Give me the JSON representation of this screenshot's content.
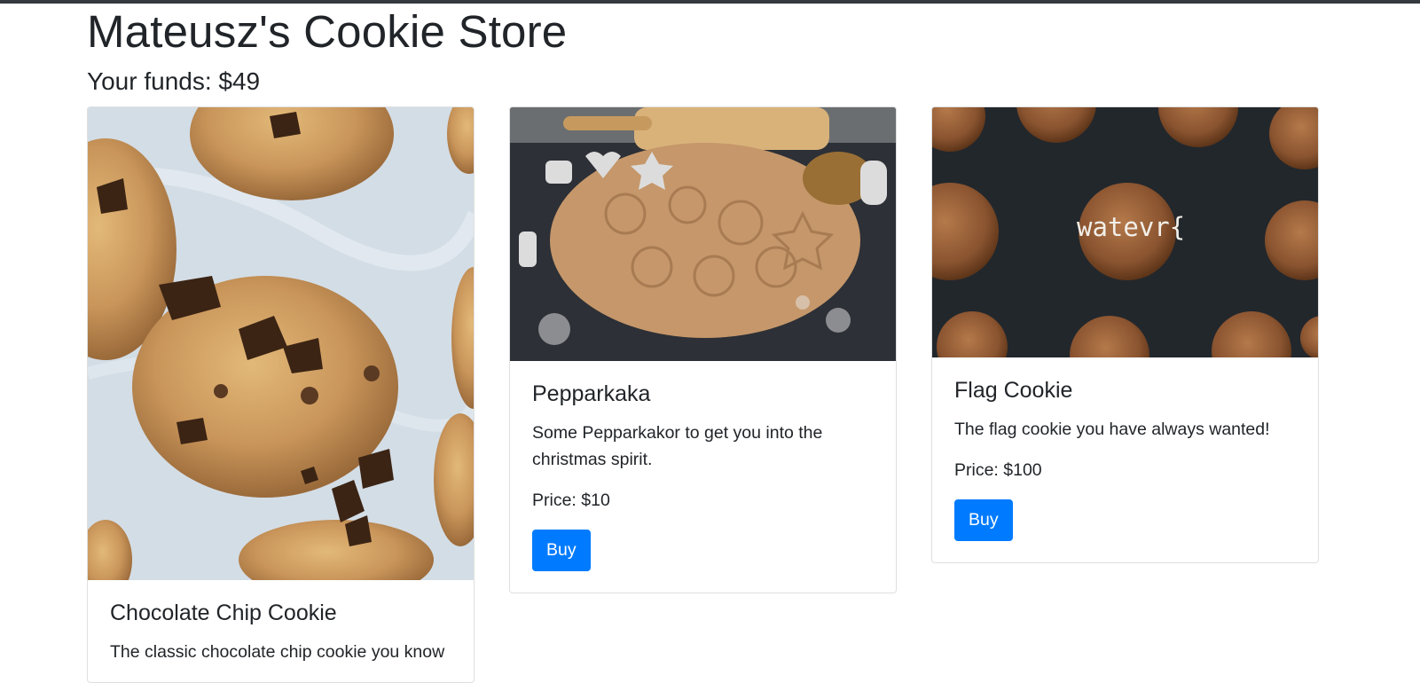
{
  "store": {
    "title": "Mateusz's Cookie Store",
    "funds": "Your funds: $49"
  },
  "products": [
    {
      "title": "Chocolate Chip Cookie",
      "description": "The classic chocolate chip cookie you know",
      "image": "chocolate-chip-cookies-photo"
    },
    {
      "title": "Pepparkaka",
      "description": "Some Pepparkakor to get you into the christmas spirit.",
      "price": "Price: $10",
      "buy_label": "Buy",
      "image": "gingerbread-dough-photo"
    },
    {
      "title": "Flag Cookie",
      "description": "The flag cookie you have always wanted!",
      "price": "Price: $100",
      "buy_label": "Buy",
      "image": "flag-cookies-photo",
      "image_overlay_text": "watevr{"
    }
  ],
  "colors": {
    "primary": "#007bff",
    "topbar": "#343a40",
    "text": "#212529"
  }
}
